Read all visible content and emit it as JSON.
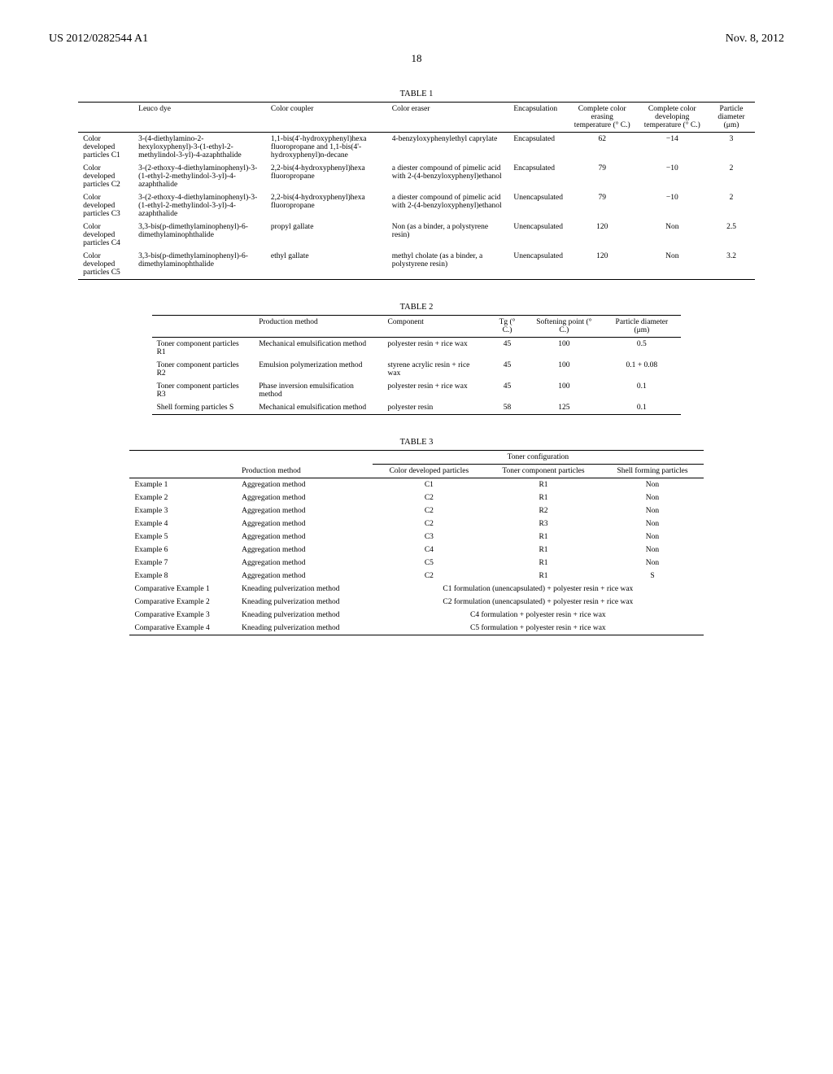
{
  "header": {
    "left": "US 2012/0282544 A1",
    "right": "Nov. 8, 2012",
    "page": "18"
  },
  "table1": {
    "caption": "TABLE 1",
    "cols": [
      "",
      "Leuco dye",
      "Color coupler",
      "Color eraser",
      "Encapsulation",
      "Complete color erasing temperature (° C.)",
      "Complete color developing temperature (° C.)",
      "Particle diameter (μm)"
    ],
    "rows": [
      {
        "name": "Color developed particles C1",
        "dye": "3-(4-diethylamino-2-hexyloxyphenyl)-3-(1-ethyl-2-methylindol-3-yl)-4-azaphthalide",
        "coupler": "1,1-bis(4'-hydroxyphenyl)hexa fluoropropane and 1,1-bis(4'-hydroxyphenyl)n-decane",
        "eraser": "4-benzyloxyphenylethyl caprylate",
        "enc": "Encapsulated",
        "erase": "62",
        "dev": "−14",
        "dia": "3"
      },
      {
        "name": "Color developed particles C2",
        "dye": "3-(2-ethoxy-4-diethylaminophenyl)-3-(1-ethyl-2-methylindol-3-yl)-4-azaphthalide",
        "coupler": "2,2-bis(4-hydroxyphenyl)hexa fluoropropane",
        "eraser": "a diester compound of pimelic acid with 2-(4-benzyloxyphenyl)ethanol",
        "enc": "Encapsulated",
        "erase": "79",
        "dev": "−10",
        "dia": "2"
      },
      {
        "name": "Color developed particles C3",
        "dye": "3-(2-ethoxy-4-diethylaminophenyl)-3-(1-ethyl-2-methylindol-3-yl)-4-azaphthalide",
        "coupler": "2,2-bis(4-hydroxyphenyl)hexa fluoropropane",
        "eraser": "a diester compound of pimelic acid with 2-(4-benzyloxyphenyl)ethanol",
        "enc": "Unencapsulated",
        "erase": "79",
        "dev": "−10",
        "dia": "2"
      },
      {
        "name": "Color developed particles C4",
        "dye": "3,3-bis(p-dimethylaminophenyl)-6-dimethylaminophthalide",
        "coupler": "propyl gallate",
        "eraser": "Non (as a binder, a polystyrene resin)",
        "enc": "Unencapsulated",
        "erase": "120",
        "dev": "Non",
        "dia": "2.5"
      },
      {
        "name": "Color developed particles C5",
        "dye": "3,3-bis(p-dimethylaminophenyl)-6-dimethylaminophthalide",
        "coupler": "ethyl gallate",
        "eraser": "methyl cholate (as a binder, a polystyrene resin)",
        "enc": "Unencapsulated",
        "erase": "120",
        "dev": "Non",
        "dia": "3.2"
      }
    ]
  },
  "table2": {
    "caption": "TABLE 2",
    "cols": [
      "",
      "Production method",
      "Component",
      "Tg (° C.)",
      "Softening point (° C.)",
      "Particle diameter (μm)"
    ],
    "rows": [
      {
        "name": "Toner component particles R1",
        "method": "Mechanical emulsification method",
        "comp": "polyester resin + rice wax",
        "tg": "45",
        "sp": "100",
        "dia": "0.5"
      },
      {
        "name": "Toner component particles R2",
        "method": "Emulsion polymerization method",
        "comp": "styrene acrylic resin + rice wax",
        "tg": "45",
        "sp": "100",
        "dia": "0.1 + 0.08"
      },
      {
        "name": "Toner component particles R3",
        "method": "Phase inversion emulsification method",
        "comp": "polyester resin + rice wax",
        "tg": "45",
        "sp": "100",
        "dia": "0.1"
      },
      {
        "name": "Shell forming particles S",
        "method": "Mechanical emulsification method",
        "comp": "polyester resin",
        "tg": "58",
        "sp": "125",
        "dia": "0.1"
      }
    ]
  },
  "table3": {
    "caption": "TABLE 3",
    "group": "Toner configuration",
    "cols": [
      "",
      "Production method",
      "Color developed particles",
      "Toner component particles",
      "Shell forming particles"
    ],
    "rows": [
      {
        "name": "Example 1",
        "method": "Aggregation method",
        "cdp": "C1",
        "tcp": "R1",
        "sfp": "Non"
      },
      {
        "name": "Example 2",
        "method": "Aggregation method",
        "cdp": "C2",
        "tcp": "R1",
        "sfp": "Non"
      },
      {
        "name": "Example 3",
        "method": "Aggregation method",
        "cdp": "C2",
        "tcp": "R2",
        "sfp": "Non"
      },
      {
        "name": "Example 4",
        "method": "Aggregation method",
        "cdp": "C2",
        "tcp": "R3",
        "sfp": "Non"
      },
      {
        "name": "Example 5",
        "method": "Aggregation method",
        "cdp": "C3",
        "tcp": "R1",
        "sfp": "Non"
      },
      {
        "name": "Example 6",
        "method": "Aggregation method",
        "cdp": "C4",
        "tcp": "R1",
        "sfp": "Non"
      },
      {
        "name": "Example 7",
        "method": "Aggregation method",
        "cdp": "C5",
        "tcp": "R1",
        "sfp": "Non"
      },
      {
        "name": "Example 8",
        "method": "Aggregation method",
        "cdp": "C2",
        "tcp": "R1",
        "sfp": "S"
      }
    ],
    "comp_rows": [
      {
        "name": "Comparative Example 1",
        "method": "Kneading pulverization method",
        "config": "C1 formulation (unencapsulated) + polyester resin + rice wax"
      },
      {
        "name": "Comparative Example 2",
        "method": "Kneading pulverization method",
        "config": "C2 formulation (unencapsulated) + polyester resin + rice wax"
      },
      {
        "name": "Comparative Example 3",
        "method": "Kneading pulverization method",
        "config": "C4 formulation + polyester resin + rice wax"
      },
      {
        "name": "Comparative Example 4",
        "method": "Kneading pulverization method",
        "config": "C5 formulation + polyester resin + rice wax"
      }
    ]
  }
}
